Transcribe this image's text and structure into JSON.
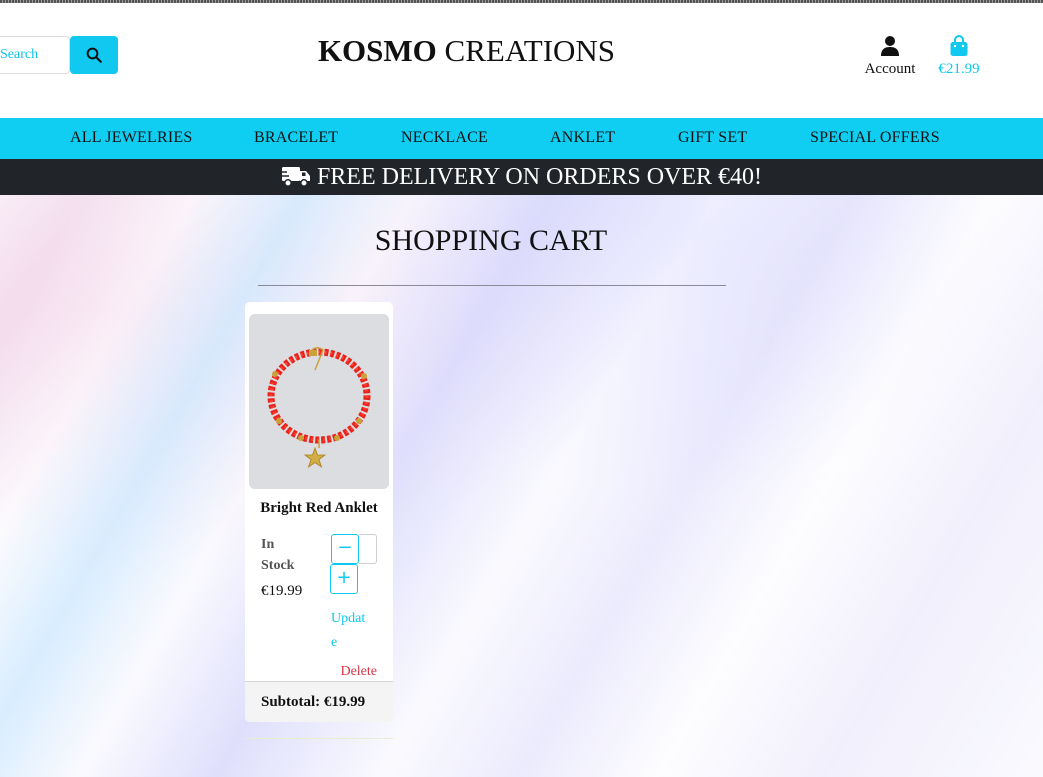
{
  "header": {
    "search_placeholder": "Search",
    "brand_bold": "KOSMO",
    "brand_rest": " CREATIONS",
    "account_label": "Account",
    "cart_total": "€21.99"
  },
  "nav": {
    "items": [
      "ALL JEWELRIES",
      "BRACELET",
      "NECKLACE",
      "ANKLET",
      "GIFT SET",
      "SPECIAL OFFERS"
    ]
  },
  "banner": {
    "text": "FREE DELIVERY ON ORDERS OVER €40!",
    "icon": "truck-icon"
  },
  "main": {
    "title": "SHOPPING CART",
    "items": [
      {
        "name": "Bright Red Anklet",
        "stock": "In Stock",
        "price": "€19.99",
        "qty_minus": "−",
        "qty_plus": "+",
        "update": "Update",
        "delete": "Delete",
        "subtotal": "Subtotal: €19.99"
      }
    ]
  },
  "colors": {
    "accent": "#10c8f0",
    "banner_bg": "#212529",
    "delete": "#dc3545"
  }
}
